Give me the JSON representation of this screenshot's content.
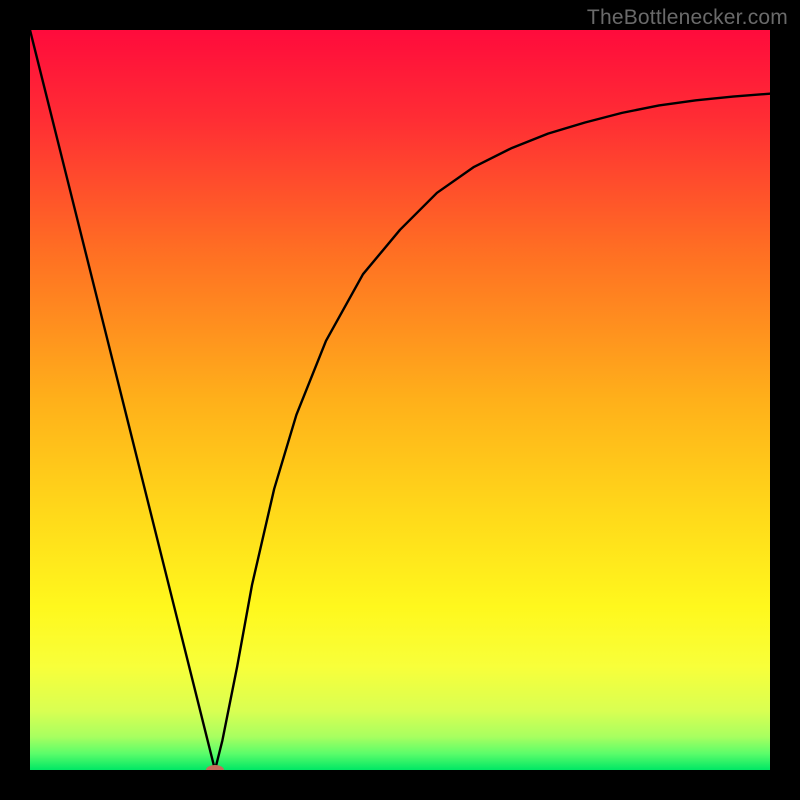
{
  "watermark": "TheBottlenecker.com",
  "chart_data": {
    "type": "line",
    "title": "",
    "xlabel": "",
    "ylabel": "",
    "xlim": [
      0,
      100
    ],
    "ylim": [
      0,
      100
    ],
    "grid": false,
    "legend": false,
    "gradient_stops": [
      {
        "offset": 0.0,
        "color": "#ff0b3c"
      },
      {
        "offset": 0.12,
        "color": "#ff2d34"
      },
      {
        "offset": 0.3,
        "color": "#ff6f23"
      },
      {
        "offset": 0.5,
        "color": "#ffb01a"
      },
      {
        "offset": 0.65,
        "color": "#ffd81a"
      },
      {
        "offset": 0.78,
        "color": "#fff81d"
      },
      {
        "offset": 0.86,
        "color": "#f8ff3a"
      },
      {
        "offset": 0.92,
        "color": "#d9ff52"
      },
      {
        "offset": 0.955,
        "color": "#a8ff60"
      },
      {
        "offset": 0.978,
        "color": "#5bfd6a"
      },
      {
        "offset": 1.0,
        "color": "#00e765"
      }
    ],
    "series": [
      {
        "name": "bottleneck-curve",
        "x": [
          0,
          5,
          10,
          15,
          20,
          22,
          24,
          25,
          26,
          28,
          30,
          33,
          36,
          40,
          45,
          50,
          55,
          60,
          65,
          70,
          75,
          80,
          85,
          90,
          95,
          100
        ],
        "y": [
          100,
          80,
          60,
          40,
          20,
          12,
          4,
          0,
          4,
          14,
          25,
          38,
          48,
          58,
          67,
          73,
          78,
          81.5,
          84,
          86,
          87.5,
          88.8,
          89.8,
          90.5,
          91,
          91.4
        ]
      }
    ],
    "marker": {
      "x": 25,
      "y": 0,
      "color": "#c76b5b",
      "rx": 9,
      "ry": 5
    }
  }
}
